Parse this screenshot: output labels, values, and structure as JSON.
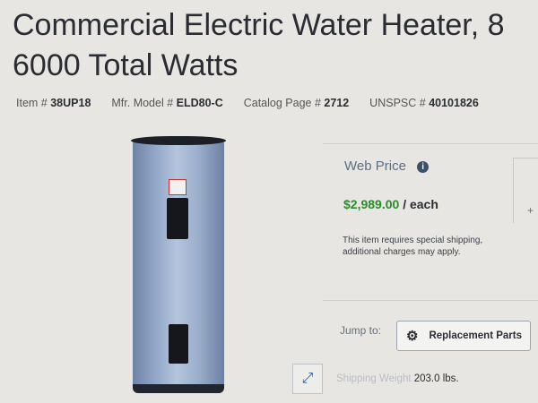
{
  "product": {
    "title_line1": "Commercial Electric Water Heater, 8",
    "title_line2": "6000 Total Watts",
    "meta": {
      "item_label": "Item #",
      "item_value": "38UP18",
      "model_label": "Mfr. Model #",
      "model_value": "ELD80-C",
      "catalog_label": "Catalog Page #",
      "catalog_value": "2712",
      "unspsc_label": "UNSPSC #",
      "unspsc_value": "40101826"
    }
  },
  "pricing": {
    "web_price_label": "Web Price",
    "info_icon": "info-icon",
    "price": "$2,989.00",
    "unit": "/ each",
    "shipping_note": "This item requires special shipping, additional charges may apply."
  },
  "jump": {
    "label": "Jump to:",
    "button_label": "Replacement Parts",
    "button_icon": "gear-icon"
  },
  "shipping": {
    "label": "Shipping Weight",
    "value": "203.0 lbs."
  },
  "colors": {
    "price_green": "#2d8a2f",
    "link_blue": "#2f5f98"
  }
}
